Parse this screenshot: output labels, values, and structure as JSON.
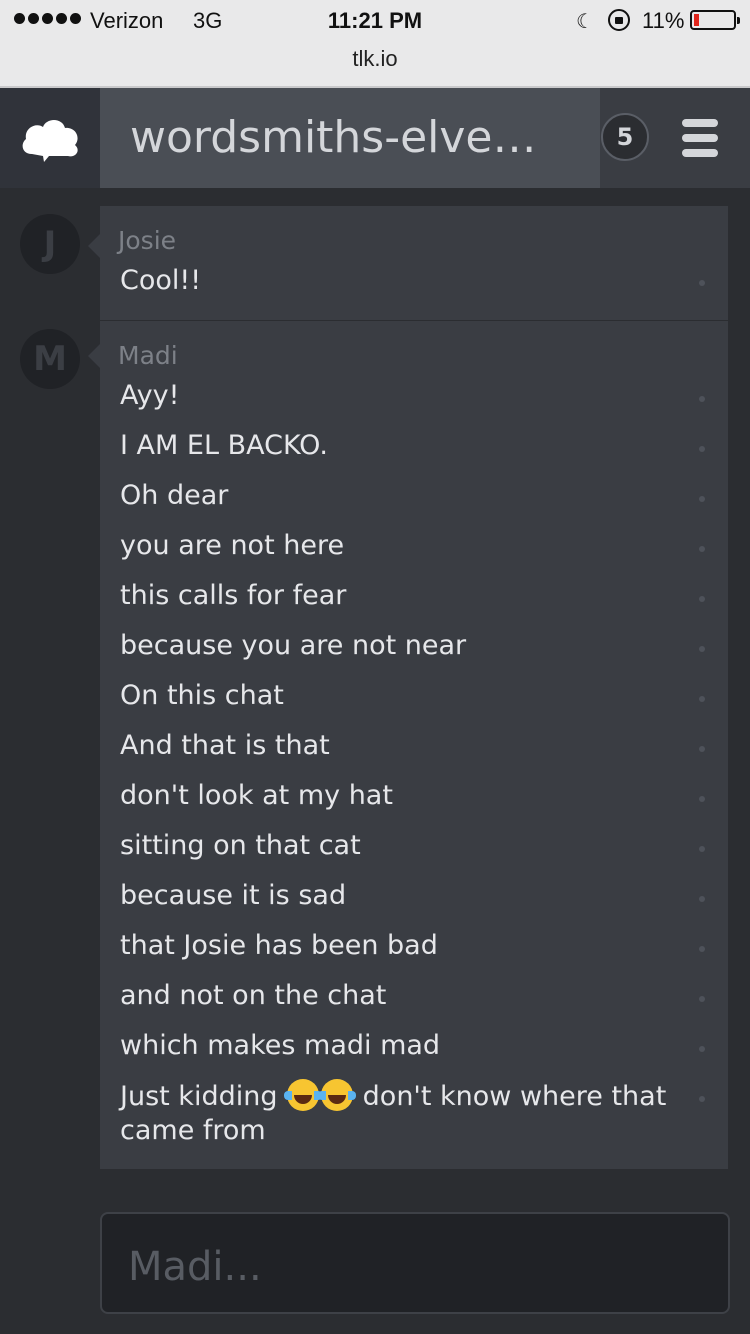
{
  "status_bar": {
    "carrier": "Verizon",
    "network": "3G",
    "time": "11:21 PM",
    "battery": "11%",
    "battery_color": "#e0251b"
  },
  "browser": {
    "url": "tlk.io"
  },
  "header": {
    "logo_icon": "cloud-icon",
    "room_title": "wordsmiths-elven-...",
    "user_count": "5",
    "menu_icon": "hamburger-icon"
  },
  "messages": [
    {
      "avatar_letter": "J",
      "sender": "Josie",
      "lines": [
        "Cool!!"
      ]
    },
    {
      "avatar_letter": "M",
      "sender": "Madi",
      "lines": [
        "Ayy!",
        "I AM EL BACKO.",
        "Oh dear",
        "you are not here",
        "this calls for fear",
        "because you are not near",
        "On this chat",
        "And that is that",
        "don't look at my hat",
        "sitting on that cat",
        "because it is sad",
        "that Josie has been bad",
        "and not on the chat",
        "which makes madi mad"
      ],
      "last_line": {
        "before_emoji": "Just kidding",
        "emoji": "face-with-tears-of-joy-icon",
        "after_emoji": " don't know where that",
        "second_line": "came from"
      }
    }
  ],
  "composer": {
    "placeholder": "Madi..."
  },
  "colors": {
    "background": "#2b2d31",
    "header": "#3a3d43",
    "bubble": "#3a3d43",
    "text": "#e6e7ea"
  }
}
